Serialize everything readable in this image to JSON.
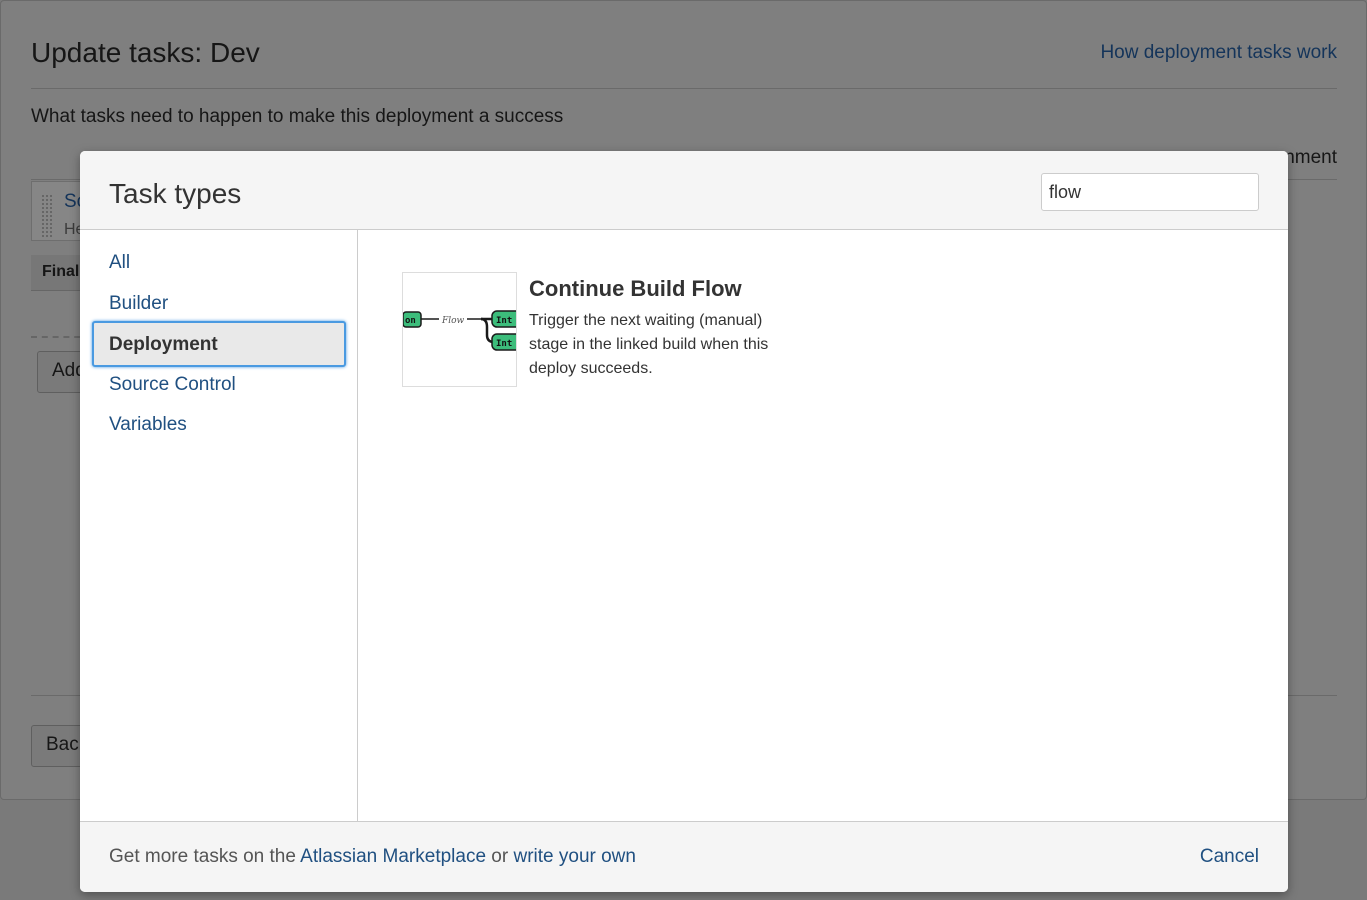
{
  "background": {
    "title": "Update tasks: Dev",
    "help_link": "How deployment tasks work",
    "description": "What tasks need to happen to make this deployment a success",
    "env_text_fragment": "nment",
    "task_name_fragment": "Sc",
    "task_sub_fragment": "He",
    "final_label_fragment": "Final",
    "add_button_fragment": "Add",
    "back_button_fragment": "Bac"
  },
  "modal": {
    "title": "Task types",
    "search": {
      "value": "flow",
      "placeholder": ""
    },
    "nav": {
      "items": [
        {
          "label": "All"
        },
        {
          "label": "Builder"
        },
        {
          "label": "Deployment"
        },
        {
          "label": "Source Control"
        },
        {
          "label": "Variables"
        }
      ],
      "selected": "Deployment"
    },
    "results": [
      {
        "name": "Continue Build Flow",
        "description": "Trigger the next waiting (manual) stage in the linked build when this deploy succeeds.",
        "thumbnail": {
          "node_left": "on",
          "edge_label": "Flow",
          "node_right_top": "Int",
          "node_right_bottom": "Int"
        }
      }
    ],
    "footer": {
      "prefix": "Get more tasks on the ",
      "marketplace_link": "Atlassian Marketplace",
      "middle": " or ",
      "own_link": "write your own",
      "cancel": "Cancel"
    }
  },
  "colors": {
    "link": "#205081",
    "selected_border": "#4a9ae1",
    "node_green": "#3cbd7b"
  }
}
